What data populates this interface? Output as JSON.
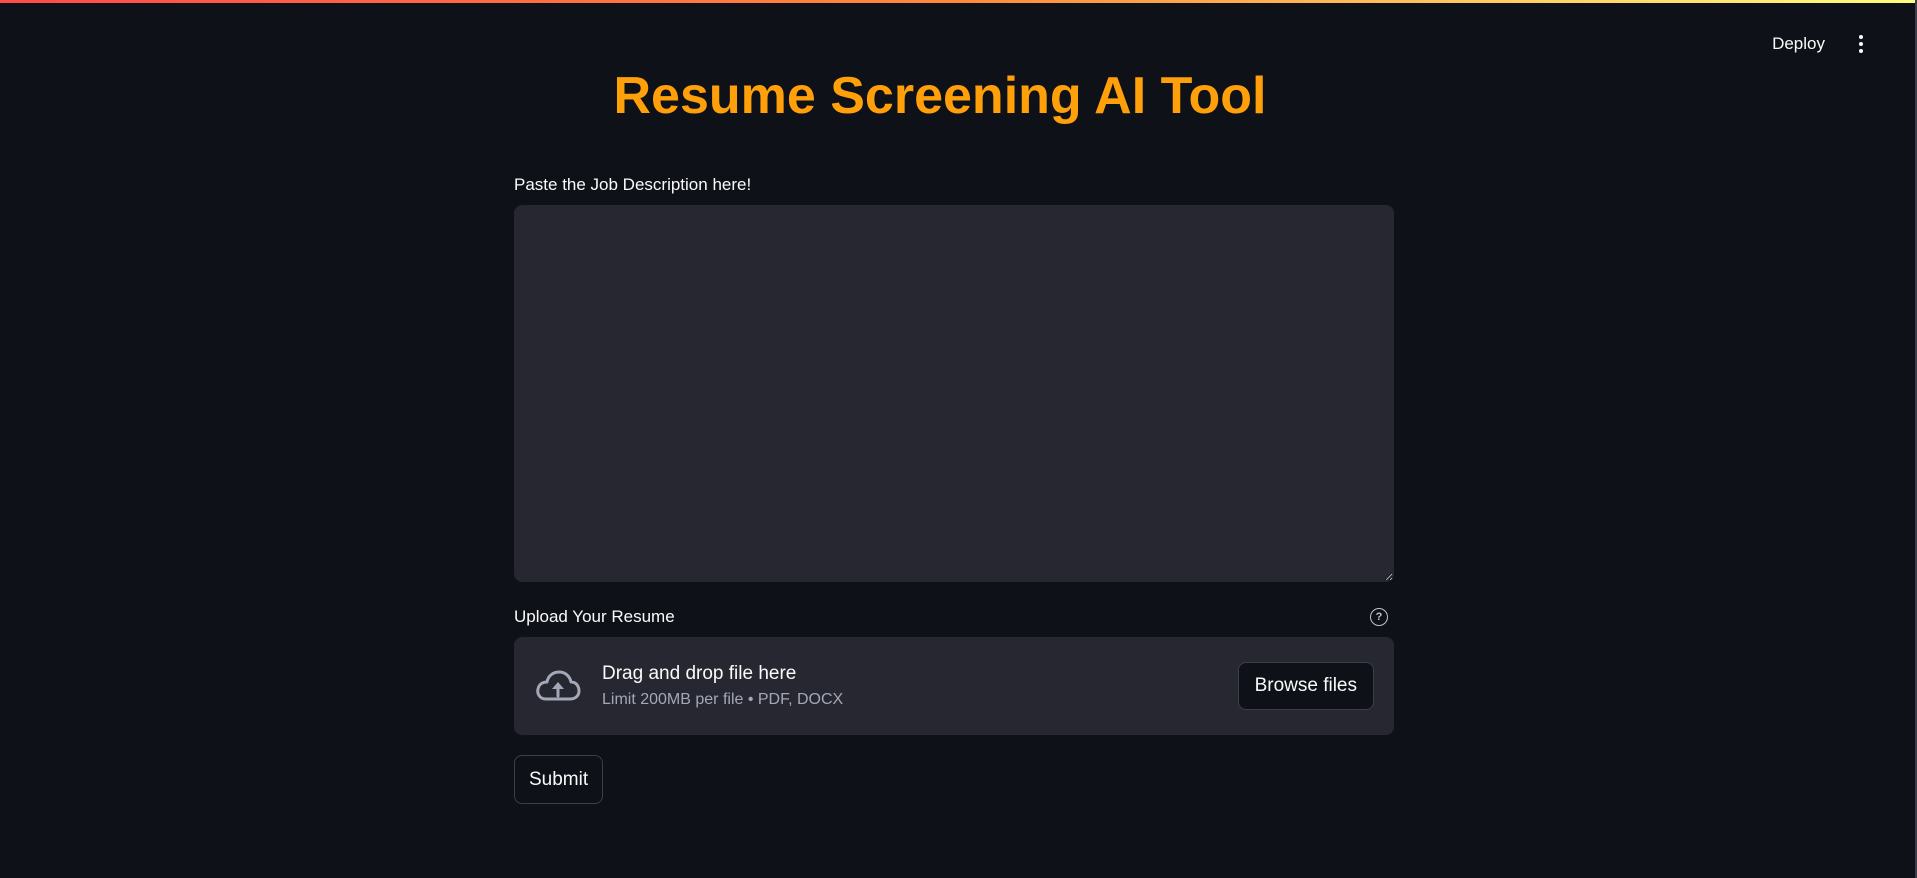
{
  "header": {
    "deploy_label": "Deploy",
    "menu_icon": "more-vertical-icon"
  },
  "title": "Resume Screening AI Tool",
  "colors": {
    "title": "#ff9f0a",
    "background": "#0e1117",
    "input_background": "#262730"
  },
  "job_description": {
    "label": "Paste the Job Description here!",
    "value": "",
    "placeholder": ""
  },
  "resume_upload": {
    "label": "Upload Your Resume",
    "help_icon": "help-circle-icon",
    "upload_icon": "cloud-upload-icon",
    "dropzone_title": "Drag and drop file here",
    "dropzone_hint": "Limit 200MB per file • PDF, DOCX",
    "browse_label": "Browse files"
  },
  "submit_label": "Submit"
}
